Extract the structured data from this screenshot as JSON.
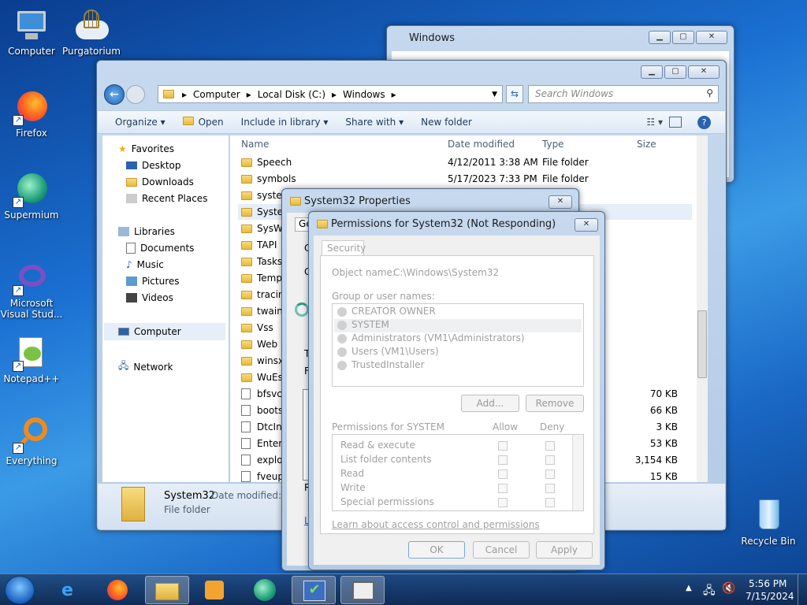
{
  "desktop": {
    "icons": [
      {
        "label": "Computer",
        "icon": "computer-icon"
      },
      {
        "label": "Purgatorium",
        "icon": "cloud-cage-icon"
      },
      {
        "label": "Firefox",
        "icon": "firefox-icon"
      },
      {
        "label": "Supermium",
        "icon": "supermium-icon"
      },
      {
        "label": "Microsoft Visual Stud...",
        "icon": "visual-studio-icon"
      },
      {
        "label": "Notepad++",
        "icon": "notepad-plus-icon"
      },
      {
        "label": "Everything",
        "icon": "everything-icon"
      },
      {
        "label": "Recycle Bin",
        "icon": "recycle-bin-icon"
      }
    ]
  },
  "bg_window": {
    "title": "Windows"
  },
  "explorer": {
    "breadcrumb": [
      "Computer",
      "Local Disk (C:)",
      "Windows"
    ],
    "search_placeholder": "Search Windows",
    "toolbar": {
      "organize": "Organize",
      "open": "Open",
      "include": "Include in library",
      "share": "Share with",
      "new_folder": "New folder"
    },
    "nav": {
      "favorites": "Favorites",
      "desktop": "Desktop",
      "downloads": "Downloads",
      "recent": "Recent Places",
      "libraries": "Libraries",
      "documents": "Documents",
      "music": "Music",
      "pictures": "Pictures",
      "videos": "Videos",
      "computer": "Computer",
      "network": "Network"
    },
    "columns": {
      "name": "Name",
      "date": "Date modified",
      "type": "Type",
      "size": "Size"
    },
    "rows": [
      {
        "name": "Speech",
        "date": "4/12/2011 3:38 AM",
        "type": "File folder",
        "size": "",
        "kind": "folder"
      },
      {
        "name": "symbols",
        "date": "5/17/2023 7:33 PM",
        "type": "File folder",
        "size": "",
        "kind": "folder"
      },
      {
        "name": "syster",
        "date": "",
        "type": "",
        "size": "",
        "kind": "folder"
      },
      {
        "name": "Syster",
        "date": "",
        "type": "",
        "size": "",
        "kind": "folder"
      },
      {
        "name": "SysW",
        "date": "",
        "type": "",
        "size": "",
        "kind": "folder"
      },
      {
        "name": "TAPI",
        "date": "",
        "type": "",
        "size": "",
        "kind": "folder"
      },
      {
        "name": "Tasks",
        "date": "",
        "type": "",
        "size": "",
        "kind": "folder"
      },
      {
        "name": "Temp",
        "date": "",
        "type": "",
        "size": "",
        "kind": "folder"
      },
      {
        "name": "tracin",
        "date": "",
        "type": "",
        "size": "",
        "kind": "folder"
      },
      {
        "name": "twain",
        "date": "",
        "type": "",
        "size": "",
        "kind": "folder"
      },
      {
        "name": "Vss",
        "date": "",
        "type": "",
        "size": "",
        "kind": "folder"
      },
      {
        "name": "Web",
        "date": "",
        "type": "",
        "size": "",
        "kind": "folder"
      },
      {
        "name": "winsx",
        "date": "",
        "type": "",
        "size": "",
        "kind": "folder"
      },
      {
        "name": "WuEs",
        "date": "",
        "type": "",
        "size": "",
        "kind": "folder"
      },
      {
        "name": "bfsvc",
        "date": "",
        "type": "",
        "size": "70 KB",
        "kind": "file"
      },
      {
        "name": "boots",
        "date": "",
        "type": "",
        "size": "66 KB",
        "kind": "file"
      },
      {
        "name": "DtcIn",
        "date": "",
        "type": "",
        "size": "3 KB",
        "kind": "file"
      },
      {
        "name": "Enter",
        "date": "",
        "type": "t",
        "size": "53 KB",
        "kind": "file"
      },
      {
        "name": "explo",
        "date": "",
        "type": "",
        "size": "3,154 KB",
        "kind": "file"
      },
      {
        "name": "fveup",
        "date": "",
        "type": "",
        "size": "15 KB",
        "kind": "file"
      }
    ],
    "details": {
      "name": "System32",
      "meta": "Date modified: 7",
      "type": "File folder"
    }
  },
  "props": {
    "title": "System32 Properties",
    "tab": "Ge",
    "letters": [
      "C",
      "G",
      "T",
      "F",
      "R",
      "L"
    ]
  },
  "perm": {
    "title": "Permissions for System32 (Not Responding)",
    "tab": "Security",
    "object_label": "Object name:",
    "object_value": "C:\\Windows\\System32",
    "group_label": "Group or user names:",
    "users": [
      "CREATOR OWNER",
      "SYSTEM",
      "Administrators (VM1\\Administrators)",
      "Users (VM1\\Users)",
      "TrustedInstaller"
    ],
    "add": "Add...",
    "remove": "Remove",
    "perm_label": "Permissions for SYSTEM",
    "allow": "Allow",
    "deny": "Deny",
    "perms": [
      "Read & execute",
      "List folder contents",
      "Read",
      "Write",
      "Special permissions"
    ],
    "link": "Learn about access control and permissions",
    "ok": "OK",
    "cancel": "Cancel",
    "apply": "Apply"
  },
  "tray": {
    "time": "5:56 PM",
    "date": "7/15/2024"
  }
}
